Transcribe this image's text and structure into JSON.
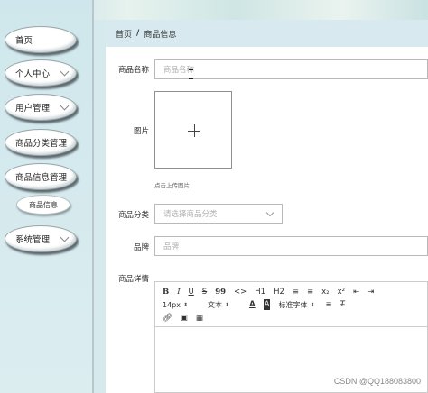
{
  "sidebar": {
    "items": [
      {
        "label": "首页"
      },
      {
        "label": "个人中心"
      },
      {
        "label": "用户管理"
      },
      {
        "label": "商品分类管理"
      },
      {
        "label": "商品信息管理"
      },
      {
        "label": "系统管理"
      }
    ],
    "sub_item": "商品信息"
  },
  "breadcrumb": {
    "home": "首页",
    "sep": "/",
    "current": "商品信息"
  },
  "form": {
    "name_label": "商品名称",
    "name_placeholder": "商品名称",
    "image_label": "图片",
    "image_hint": "点击上传图片",
    "category_label": "商品分类",
    "category_placeholder": "请选择商品分类",
    "brand_label": "品牌",
    "brand_placeholder": "品牌",
    "detail_label": "商品详情"
  },
  "editor": {
    "row1": [
      "B",
      "I",
      "U",
      "S",
      "99",
      "<>",
      "H1",
      "H2",
      "≡",
      "≡",
      "x₂",
      "x²",
      "⇤",
      "⇥"
    ],
    "size": "14px",
    "text_type": "文本",
    "font_label": "标准字体",
    "row2_extra": [
      "A",
      "A"
    ]
  },
  "watermark": "CSDN @QQ188083800"
}
